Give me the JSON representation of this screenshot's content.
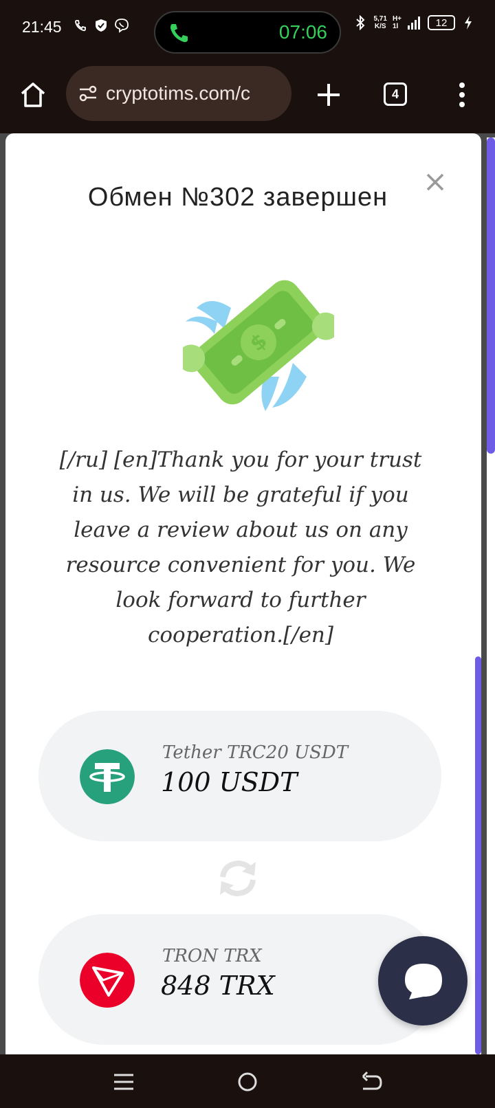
{
  "status_bar": {
    "time": "21:45",
    "call_timer": "07:06",
    "speed_value": "5,71",
    "speed_unit": "K/S",
    "network_top": "H+",
    "network_bottom": "1l",
    "battery": "12"
  },
  "browser": {
    "url": "cryptotims.com/c",
    "tab_count": "4"
  },
  "modal": {
    "title": "Обмен №302 завершен",
    "message": "[/ru] [en]Thank you for your trust in us. We will be grateful if you leave a review about us on any resource convenient for you. We look forward to further cooperation.[/en]",
    "from": {
      "name": "Tether TRC20 USDT",
      "amount": "100 USDT",
      "color": "#26a17b"
    },
    "to": {
      "name": "TRON TRX",
      "amount": "848 TRX",
      "color": "#eb0029"
    }
  },
  "colors": {
    "accent_scrollbar": "#6f5ce6",
    "chat_button": "#2b2f48",
    "call_timer": "#35d05b"
  }
}
